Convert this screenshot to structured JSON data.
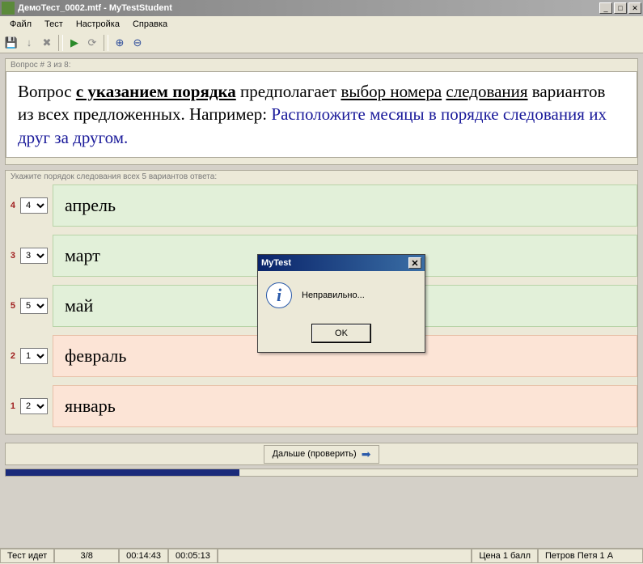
{
  "window": {
    "title": "ДемоТест_0002.mtf - MyTestStudent",
    "minimize": "_",
    "maximize": "□",
    "close": "✕"
  },
  "menu": {
    "file": "Файл",
    "test": "Тест",
    "settings": "Настройка",
    "help": "Справка"
  },
  "question_header": "Вопрос # 3 из 8:",
  "question": {
    "prefix": "Вопрос ",
    "bold_underlined": "с указанием порядка",
    "mid1": " предполагает ",
    "underlined1": "выбор номера",
    "underlined2": "следования",
    "mid2": " вариантов из всех предложенных. Например: ",
    "task": "Расположите месяцы в порядке следования их друг за другом."
  },
  "answers_header": "Укажите порядок следования всех 5 вариантов ответа:",
  "answers": [
    {
      "num": "4",
      "sel": "4",
      "text": "апрель",
      "wrong": false
    },
    {
      "num": "3",
      "sel": "3",
      "text": "март",
      "wrong": false
    },
    {
      "num": "5",
      "sel": "5",
      "text": "май",
      "wrong": false
    },
    {
      "num": "2",
      "sel": "1",
      "text": "февраль",
      "wrong": true
    },
    {
      "num": "1",
      "sel": "2",
      "text": "январь",
      "wrong": true
    }
  ],
  "next_button": "Дальше (проверить)",
  "dialog": {
    "title": "MyTest",
    "message": "Неправильно...",
    "ok": "OK",
    "close": "✕"
  },
  "status": {
    "running": "Тест идет",
    "progress": "3/8",
    "time1": "00:14:43",
    "time2": "00:05:13",
    "price": "Цена 1 балл",
    "user": "Петров Петя 1 А"
  }
}
